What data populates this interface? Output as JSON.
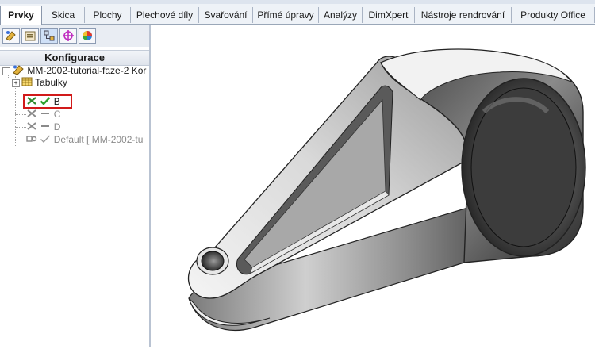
{
  "tabs": [
    {
      "label": "Prvky",
      "active": true
    },
    {
      "label": "Skica"
    },
    {
      "label": "Plochy"
    },
    {
      "label": "Plechové díly"
    },
    {
      "label": "Svařování"
    },
    {
      "label": "Přímé úpravy"
    },
    {
      "label": "Analýzy"
    },
    {
      "label": "DimXpert"
    },
    {
      "label": "Nástroje rendrování"
    },
    {
      "label": "Produkty Office"
    }
  ],
  "panel": {
    "toolbar_icons": [
      "feature-manager-icon",
      "property-manager-icon",
      "configuration-manager-icon",
      "dimxpert-manager-icon",
      "display-manager-icon"
    ],
    "title": "Konfigurace",
    "tree": {
      "root": "MM-2002-tutorial-faze-2 Kor",
      "tables": "Tabulky",
      "configs": [
        {
          "label": "B",
          "active": true
        },
        {
          "label": "C"
        },
        {
          "label": "D"
        },
        {
          "label": "Default [ MM-2002-tu"
        }
      ]
    }
  },
  "colors": {
    "highlight": "#d11a1a",
    "active_check": "#2ea02e",
    "tab_bg": "#eef2f7"
  }
}
